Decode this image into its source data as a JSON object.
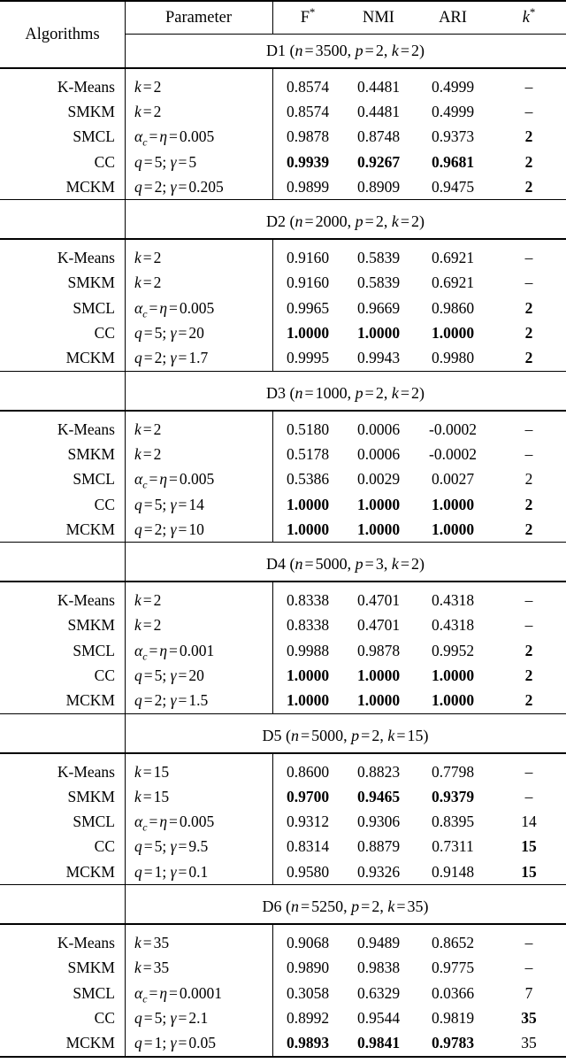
{
  "table": {
    "columns": {
      "algorithms": "Algorithms",
      "parameter": "Parameter",
      "f_star": "F",
      "f_star_sup": "*",
      "nmi": "NMI",
      "ari": "ARI",
      "k_star": "k",
      "k_star_sup": "*"
    },
    "dash": "–",
    "sections": [
      {
        "id": "D1",
        "title": "D1",
        "n": "3500",
        "p": "2",
        "k": "2",
        "rows": [
          {
            "algorithm": "K-Means",
            "param_type": "k",
            "param_k": "2",
            "f": "0.8574",
            "nmi": "0.4481",
            "ari": "0.4999",
            "kstar": "–",
            "bold_metrics": false,
            "bold_kstar": false
          },
          {
            "algorithm": "SMKM",
            "param_type": "k",
            "param_k": "2",
            "f": "0.8574",
            "nmi": "0.4481",
            "ari": "0.4999",
            "kstar": "–",
            "bold_metrics": false,
            "bold_kstar": false
          },
          {
            "algorithm": "SMCL",
            "param_type": "alpha",
            "param_alpha": "0.005",
            "f": "0.9878",
            "nmi": "0.8748",
            "ari": "0.9373",
            "kstar": "2",
            "bold_metrics": false,
            "bold_kstar": true
          },
          {
            "algorithm": "CC",
            "param_type": "qgamma",
            "param_q": "5",
            "param_gamma": "5",
            "f": "0.9939",
            "nmi": "0.9267",
            "ari": "0.9681",
            "kstar": "2",
            "bold_metrics": true,
            "bold_kstar": true
          },
          {
            "algorithm": "MCKM",
            "param_type": "qgamma",
            "param_q": "2",
            "param_gamma": "0.205",
            "f": "0.9899",
            "nmi": "0.8909",
            "ari": "0.9475",
            "kstar": "2",
            "bold_metrics": false,
            "bold_kstar": true
          }
        ]
      },
      {
        "id": "D2",
        "title": "D2",
        "n": "2000",
        "p": "2",
        "k": "2",
        "rows": [
          {
            "algorithm": "K-Means",
            "param_type": "k",
            "param_k": "2",
            "f": "0.9160",
            "nmi": "0.5839",
            "ari": "0.6921",
            "kstar": "–",
            "bold_metrics": false,
            "bold_kstar": false
          },
          {
            "algorithm": "SMKM",
            "param_type": "k",
            "param_k": "2",
            "f": "0.9160",
            "nmi": "0.5839",
            "ari": "0.6921",
            "kstar": "–",
            "bold_metrics": false,
            "bold_kstar": false
          },
          {
            "algorithm": "SMCL",
            "param_type": "alpha",
            "param_alpha": "0.005",
            "f": "0.9965",
            "nmi": "0.9669",
            "ari": "0.9860",
            "kstar": "2",
            "bold_metrics": false,
            "bold_kstar": true
          },
          {
            "algorithm": "CC",
            "param_type": "qgamma",
            "param_q": "5",
            "param_gamma": "20",
            "f": "1.0000",
            "nmi": "1.0000",
            "ari": "1.0000",
            "kstar": "2",
            "bold_metrics": true,
            "bold_kstar": true
          },
          {
            "algorithm": "MCKM",
            "param_type": "qgamma",
            "param_q": "2",
            "param_gamma": "1.7",
            "f": "0.9995",
            "nmi": "0.9943",
            "ari": "0.9980",
            "kstar": "2",
            "bold_metrics": false,
            "bold_kstar": true
          }
        ]
      },
      {
        "id": "D3",
        "title": "D3",
        "n": "1000",
        "p": "2",
        "k": "2",
        "rows": [
          {
            "algorithm": "K-Means",
            "param_type": "k",
            "param_k": "2",
            "f": "0.5180",
            "nmi": "0.0006",
            "ari": "-0.0002",
            "kstar": "–",
            "bold_metrics": false,
            "bold_kstar": false
          },
          {
            "algorithm": "SMKM",
            "param_type": "k",
            "param_k": "2",
            "f": "0.5178",
            "nmi": "0.0006",
            "ari": "-0.0002",
            "kstar": "–",
            "bold_metrics": false,
            "bold_kstar": false
          },
          {
            "algorithm": "SMCL",
            "param_type": "alpha",
            "param_alpha": "0.005",
            "f": "0.5386",
            "nmi": "0.0029",
            "ari": "0.0027",
            "kstar": "2",
            "bold_metrics": false,
            "bold_kstar": false
          },
          {
            "algorithm": "CC",
            "param_type": "qgamma",
            "param_q": "5",
            "param_gamma": "14",
            "f": "1.0000",
            "nmi": "1.0000",
            "ari": "1.0000",
            "kstar": "2",
            "bold_metrics": true,
            "bold_kstar": true
          },
          {
            "algorithm": "MCKM",
            "param_type": "qgamma",
            "param_q": "2",
            "param_gamma": "10",
            "f": "1.0000",
            "nmi": "1.0000",
            "ari": "1.0000",
            "kstar": "2",
            "bold_metrics": true,
            "bold_kstar": true
          }
        ]
      },
      {
        "id": "D4",
        "title": "D4",
        "n": "5000",
        "p": "3",
        "k": "2",
        "rows": [
          {
            "algorithm": "K-Means",
            "param_type": "k",
            "param_k": "2",
            "f": "0.8338",
            "nmi": "0.4701",
            "ari": "0.4318",
            "kstar": "–",
            "bold_metrics": false,
            "bold_kstar": false
          },
          {
            "algorithm": "SMKM",
            "param_type": "k",
            "param_k": "2",
            "f": "0.8338",
            "nmi": "0.4701",
            "ari": "0.4318",
            "kstar": "–",
            "bold_metrics": false,
            "bold_kstar": false
          },
          {
            "algorithm": "SMCL",
            "param_type": "alpha",
            "param_alpha": "0.001",
            "f": "0.9988",
            "nmi": "0.9878",
            "ari": "0.9952",
            "kstar": "2",
            "bold_metrics": false,
            "bold_kstar": true
          },
          {
            "algorithm": "CC",
            "param_type": "qgamma",
            "param_q": "5",
            "param_gamma": "20",
            "f": "1.0000",
            "nmi": "1.0000",
            "ari": "1.0000",
            "kstar": "2",
            "bold_metrics": true,
            "bold_kstar": true
          },
          {
            "algorithm": "MCKM",
            "param_type": "qgamma",
            "param_q": "2",
            "param_gamma": "1.5",
            "f": "1.0000",
            "nmi": "1.0000",
            "ari": "1.0000",
            "kstar": "2",
            "bold_metrics": true,
            "bold_kstar": true
          }
        ]
      },
      {
        "id": "D5",
        "title": "D5",
        "n": "5000",
        "p": "2",
        "k": "15",
        "rows": [
          {
            "algorithm": "K-Means",
            "param_type": "k",
            "param_k": "15",
            "f": "0.8600",
            "nmi": "0.8823",
            "ari": "0.7798",
            "kstar": "–",
            "bold_metrics": false,
            "bold_kstar": false
          },
          {
            "algorithm": "SMKM",
            "param_type": "k",
            "param_k": "15",
            "f": "0.9700",
            "nmi": "0.9465",
            "ari": "0.9379",
            "kstar": "–",
            "bold_metrics": true,
            "bold_kstar": false
          },
          {
            "algorithm": "SMCL",
            "param_type": "alpha",
            "param_alpha": "0.005",
            "f": "0.9312",
            "nmi": "0.9306",
            "ari": "0.8395",
            "kstar": "14",
            "bold_metrics": false,
            "bold_kstar": false
          },
          {
            "algorithm": "CC",
            "param_type": "qgamma",
            "param_q": "5",
            "param_gamma": "9.5",
            "f": "0.8314",
            "nmi": "0.8879",
            "ari": "0.7311",
            "kstar": "15",
            "bold_metrics": false,
            "bold_kstar": true
          },
          {
            "algorithm": "MCKM",
            "param_type": "qgamma",
            "param_q": "1",
            "param_gamma": "0.1",
            "f": "0.9580",
            "nmi": "0.9326",
            "ari": "0.9148",
            "kstar": "15",
            "bold_metrics": false,
            "bold_kstar": true
          }
        ]
      },
      {
        "id": "D6",
        "title": "D6",
        "n": "5250",
        "p": "2",
        "k": "35",
        "rows": [
          {
            "algorithm": "K-Means",
            "param_type": "k",
            "param_k": "35",
            "f": "0.9068",
            "nmi": "0.9489",
            "ari": "0.8652",
            "kstar": "–",
            "bold_metrics": false,
            "bold_kstar": false
          },
          {
            "algorithm": "SMKM",
            "param_type": "k",
            "param_k": "35",
            "f": "0.9890",
            "nmi": "0.9838",
            "ari": "0.9775",
            "kstar": "–",
            "bold_metrics": false,
            "bold_kstar": false
          },
          {
            "algorithm": "SMCL",
            "param_type": "alpha",
            "param_alpha": "0.0001",
            "f": "0.3058",
            "nmi": "0.6329",
            "ari": "0.0366",
            "kstar": "7",
            "bold_metrics": false,
            "bold_kstar": false
          },
          {
            "algorithm": "CC",
            "param_type": "qgamma",
            "param_q": "5",
            "param_gamma": "2.1",
            "f": "0.8992",
            "nmi": "0.9544",
            "ari": "0.9819",
            "kstar": "35",
            "bold_metrics": false,
            "bold_kstar": true
          },
          {
            "algorithm": "MCKM",
            "param_type": "qgamma",
            "param_q": "1",
            "param_gamma": "0.05",
            "f": "0.9893",
            "nmi": "0.9841",
            "ari": "0.9783",
            "kstar": "35",
            "bold_metrics": true,
            "bold_kstar": false
          }
        ]
      }
    ]
  }
}
